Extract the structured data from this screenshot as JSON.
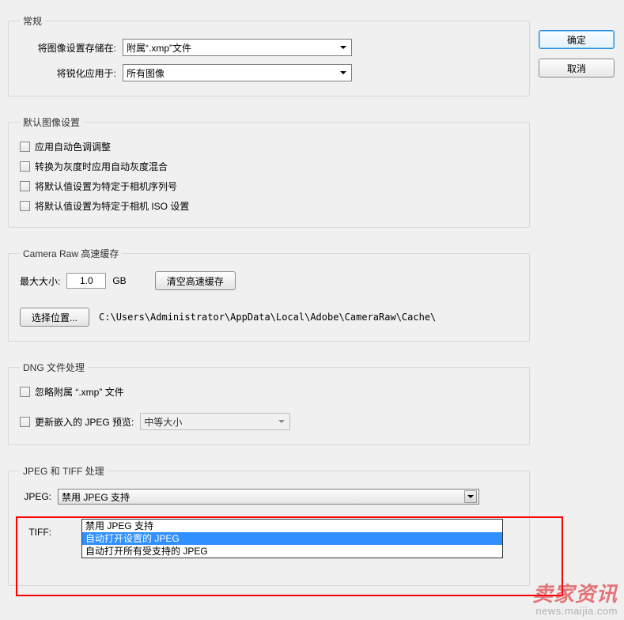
{
  "buttons": {
    "ok": "确定",
    "cancel": "取消"
  },
  "general": {
    "legend": "常规",
    "save_settings_label": "将图像设置存储在:",
    "save_settings_value": "附属“.xmp”文件",
    "sharpen_apply_label": "将锐化应用于:",
    "sharpen_apply_value": "所有图像"
  },
  "defaults": {
    "legend": "默认图像设置",
    "opt1": "应用自动色调调整",
    "opt2": "转换为灰度时应用自动灰度混合",
    "opt3": "将默认值设置为特定于相机序列号",
    "opt4": "将默认值设置为特定于相机 ISO 设置"
  },
  "cache": {
    "legend": "Camera Raw 高速缓存",
    "max_size_label": "最大大小:",
    "max_size_value": "1.0",
    "max_size_unit": "GB",
    "clear_button": "清空高速缓存",
    "select_location_button": "选择位置...",
    "path": "C:\\Users\\Administrator\\AppData\\Local\\Adobe\\CameraRaw\\Cache\\"
  },
  "dng": {
    "legend": "DNG 文件处理",
    "ignore_xmp": "忽略附属 “.xmp” 文件",
    "update_jpeg": "更新嵌入的 JPEG 预览:",
    "preview_size": "中等大小"
  },
  "jpeg": {
    "legend": "JPEG 和 TIFF 处理",
    "jpeg_label": "JPEG:",
    "tiff_label": "TIFF:",
    "selected": "禁用 JPEG 支持",
    "options": [
      "禁用 JPEG 支持",
      "自动打开设置的 JPEG",
      "自动打开所有受支持的 JPEG"
    ]
  },
  "watermark": {
    "brand": "卖家资讯",
    "url": "news.maijia.com"
  }
}
